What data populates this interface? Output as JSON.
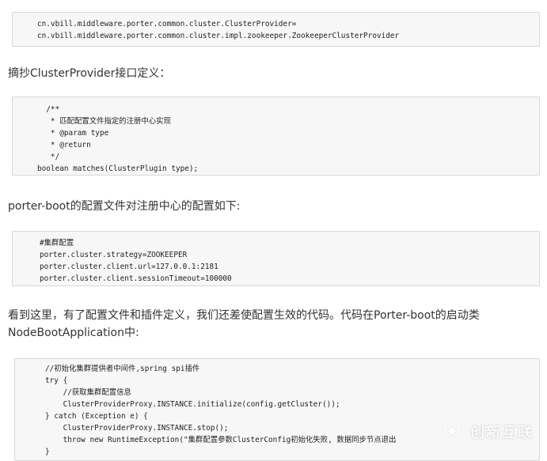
{
  "blocks": [
    {
      "lines": [
        "cn.vbill.middleware.porter.common.cluster.ClusterProvider=",
        "cn.vbill.middleware.porter.common.cluster.impl.zookeeper.ZookeeperClusterProvider"
      ]
    },
    {
      "lines": [
        "  /**",
        "   * 匹配配置文件指定的注册中心实现",
        "   * @param type",
        "   * @return",
        "   */",
        "boolean matches(ClusterPlugin type);"
      ]
    },
    {
      "lines": [
        "#集群配置",
        "porter.cluster.strategy=ZOOKEEPER",
        "porter.cluster.client.url=127.0.0.1:2181",
        "porter.cluster.client.sessionTimeout=100000"
      ]
    },
    {
      "lines": [
        "//初始化集群提供者中间件,spring spi插件",
        "try {",
        "    //获取集群配置信息",
        "    ClusterProviderProxy.INSTANCE.initialize(config.getCluster());",
        "} catch (Exception e) {",
        "    ClusterProviderProxy.INSTANCE.stop();",
        "    throw new RuntimeException(\"集群配置参数ClusterConfig初始化失败, 数据同步节点退出",
        "}"
      ]
    }
  ],
  "paragraphs": {
    "p1": "摘抄ClusterProvider接口定义：",
    "p2": "porter-boot的配置文件对注册中心的配置如下:",
    "p3_line1": "看到这里，有了配置文件和插件定义，我们还差使配置生效的代码。代码在Porter-boot的启动类",
    "p3_line2": "NodeBootApplication中:"
  },
  "watermark": {
    "text": "创新互联",
    "icon": "brand-logo-icon"
  }
}
